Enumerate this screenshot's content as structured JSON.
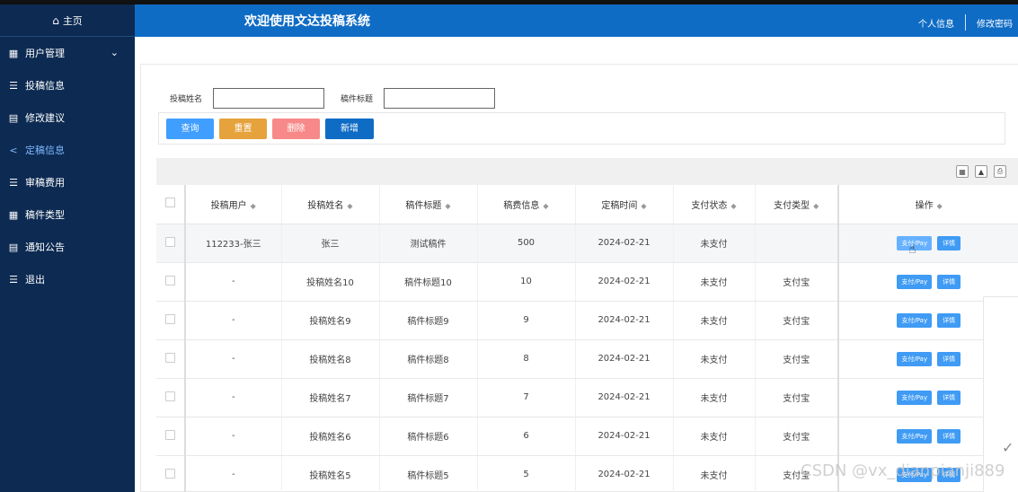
{
  "sidebar": {
    "home_label": "主页",
    "items": [
      {
        "label": "用户管理",
        "icon": "grid-icon",
        "has_children": true
      },
      {
        "label": "投稿信息",
        "icon": "list-icon"
      },
      {
        "label": "修改建议",
        "icon": "book-icon"
      },
      {
        "label": "定稿信息",
        "icon": "share-icon",
        "active": true
      },
      {
        "label": "审稿费用",
        "icon": "list-icon"
      },
      {
        "label": "稿件类型",
        "icon": "grid-icon"
      },
      {
        "label": "通知公告",
        "icon": "book-icon"
      },
      {
        "label": "退出",
        "icon": "list-icon"
      }
    ]
  },
  "header": {
    "title": "欢迎使用文达投稿系统",
    "profile_link": "个人信息",
    "password_link": "修改密码"
  },
  "search": {
    "field1_label": "投稿姓名",
    "field1_value": "",
    "field2_label": "稿件标题",
    "field2_value": ""
  },
  "buttons": {
    "query": "查询",
    "reset": "重置",
    "delete": "删除",
    "add": "新增"
  },
  "colors": {
    "sidebar": "#0c2a52",
    "header": "#0f6cc5",
    "query_btn": "#409eff",
    "reset_btn": "#e6a23c",
    "delete_btn": "#f78989",
    "add_btn": "#0f6cc5"
  },
  "table": {
    "columns": [
      "投稿用户",
      "投稿姓名",
      "稿件标题",
      "稿费信息",
      "定稿时间",
      "支付状态",
      "支付类型",
      "操作"
    ],
    "pay_label": "支付/Pay",
    "detail_label": "详情",
    "rows": [
      [
        "112233-张三",
        "张三",
        "测试稿件",
        "500",
        "2024-02-21",
        "未支付",
        ""
      ],
      [
        "-",
        "投稿姓名10",
        "稿件标题10",
        "10",
        "2024-02-21",
        "未支付",
        "支付宝"
      ],
      [
        "-",
        "投稿姓名9",
        "稿件标题9",
        "9",
        "2024-02-21",
        "未支付",
        "支付宝"
      ],
      [
        "-",
        "投稿姓名8",
        "稿件标题8",
        "8",
        "2024-02-21",
        "未支付",
        "支付宝"
      ],
      [
        "-",
        "投稿姓名7",
        "稿件标题7",
        "7",
        "2024-02-21",
        "未支付",
        "支付宝"
      ],
      [
        "-",
        "投稿姓名6",
        "稿件标题6",
        "6",
        "2024-02-21",
        "未支付",
        "支付宝"
      ],
      [
        "-",
        "投稿姓名5",
        "稿件标题5",
        "5",
        "2024-02-21",
        "未支付",
        "支付宝"
      ]
    ]
  },
  "watermark": "CSDN @vx_dianpianji889"
}
